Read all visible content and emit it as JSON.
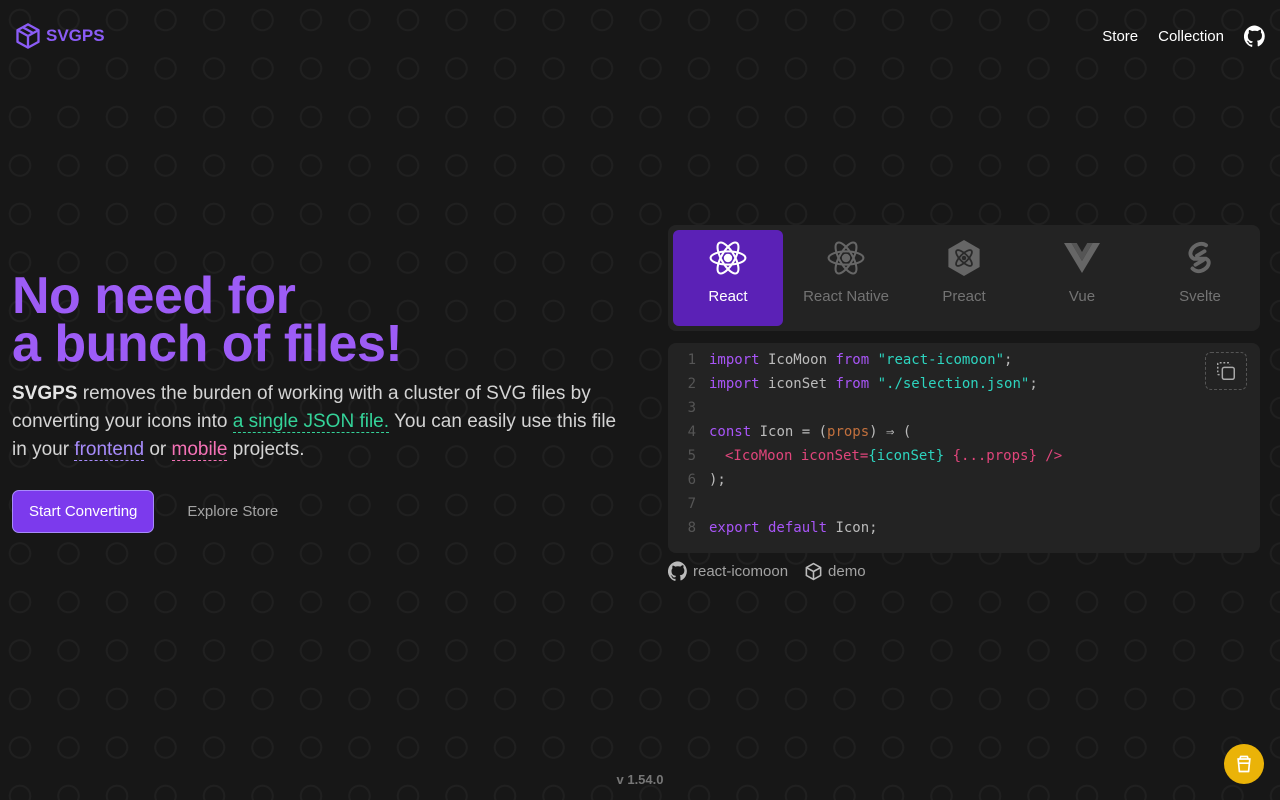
{
  "brand": {
    "name": "SVGPS",
    "color": "#8b5cf6"
  },
  "nav": {
    "store": "Store",
    "collection": "Collection"
  },
  "hero": {
    "title_line1": "No need for",
    "title_line2": "a bunch of files!",
    "desc_brand": "SVGPS",
    "desc_1": " removes the burden of working with a cluster of SVG files by converting your icons into ",
    "desc_link1": "a single JSON file.",
    "desc_2": " You can easily use this file in your ",
    "desc_link2": "frontend",
    "desc_3": " or ",
    "desc_link3": "mobile",
    "desc_4": " projects.",
    "start": "Start Converting",
    "explore": "Explore Store"
  },
  "tabs": [
    {
      "label": "React"
    },
    {
      "label": "React Native"
    },
    {
      "label": "Preact"
    },
    {
      "label": "Vue"
    },
    {
      "label": "Svelte"
    }
  ],
  "code": {
    "lines": [
      "1",
      "2",
      "3",
      "4",
      "5",
      "6",
      "7",
      "8"
    ],
    "l1": [
      "import",
      " IcoMoon ",
      "from",
      " \"react-icomoon\"",
      ";"
    ],
    "l2": [
      "import",
      " iconSet ",
      "from",
      " \"./selection.json\"",
      ";"
    ],
    "l4": [
      "const",
      " Icon = (",
      "props",
      ") ⇒ ("
    ],
    "l5": [
      "<IcoMoon iconSet=",
      "{iconSet}",
      " {...props} />"
    ],
    "l6": ");",
    "l8": [
      "export default",
      " Icon;"
    ]
  },
  "links": {
    "repo": "react-icomoon",
    "demo": "demo"
  },
  "version": "v 1.54.0"
}
